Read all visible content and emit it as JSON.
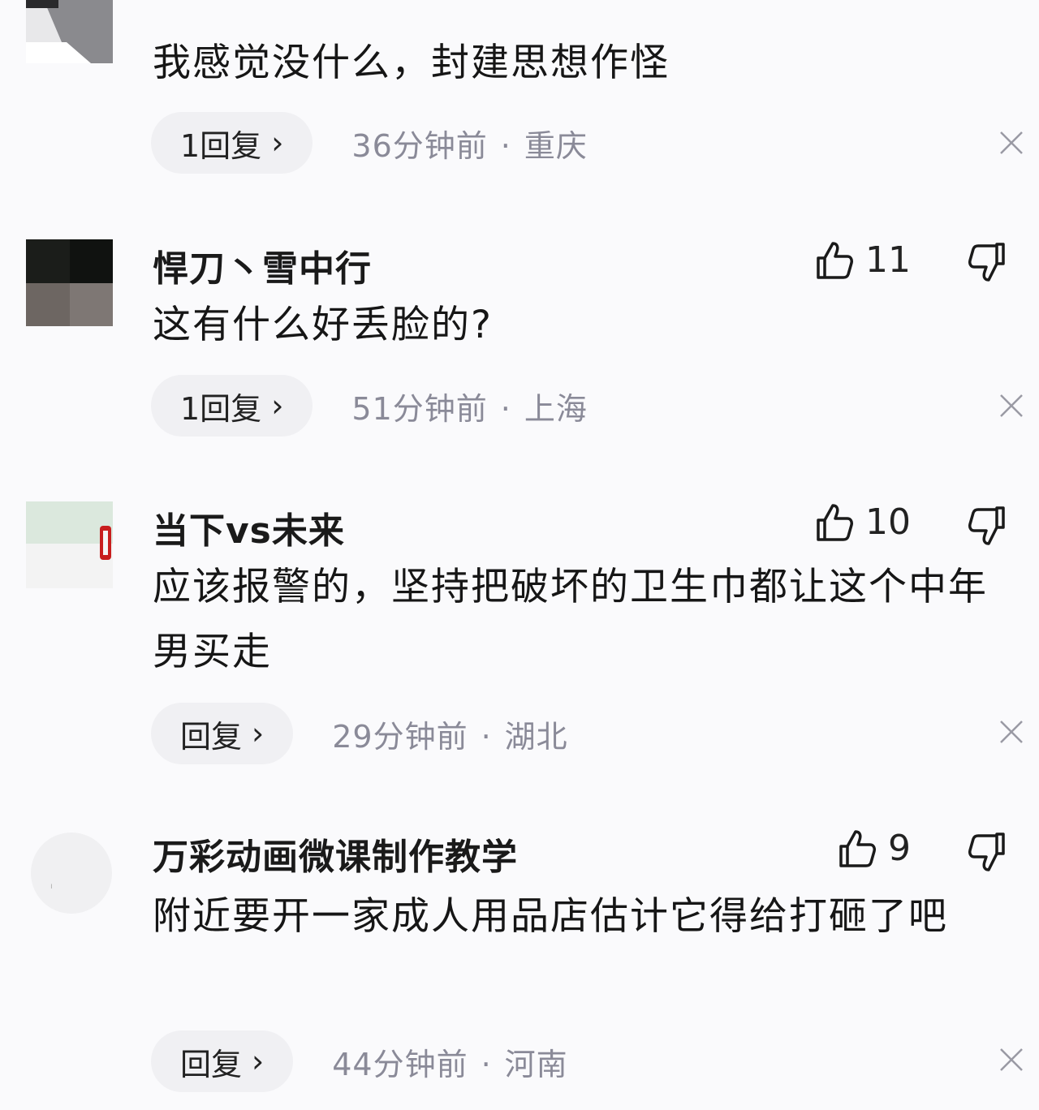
{
  "comments": [
    {
      "username": "",
      "text": "我感觉没什么，封建思想作怪",
      "likes": "",
      "reply_label": "1回复",
      "time": "36分钟前",
      "location": "重庆"
    },
    {
      "username": "悍刀丶雪中行",
      "text": "这有什么好丢脸的?",
      "likes": "11",
      "reply_label": "1回复",
      "time": "51分钟前",
      "location": "上海"
    },
    {
      "username": "当下vs未来",
      "text": "应该报警的，坚持把破坏的卫生巾都让这个中年男买走",
      "likes": "10",
      "reply_label": "回复",
      "time": "29分钟前",
      "location": "湖北"
    },
    {
      "username": "万彩动画微课制作教学",
      "text": "附近要开一家成人用品店估计它得给打砸了吧",
      "likes": "9",
      "reply_label": "回复",
      "time": "44分钟前",
      "location": "河南"
    }
  ],
  "separator": "·",
  "icons": {
    "like": "thumbs-up-icon",
    "dislike": "thumbs-down-icon",
    "close": "close-icon",
    "chevron": "chevron-right-icon"
  }
}
